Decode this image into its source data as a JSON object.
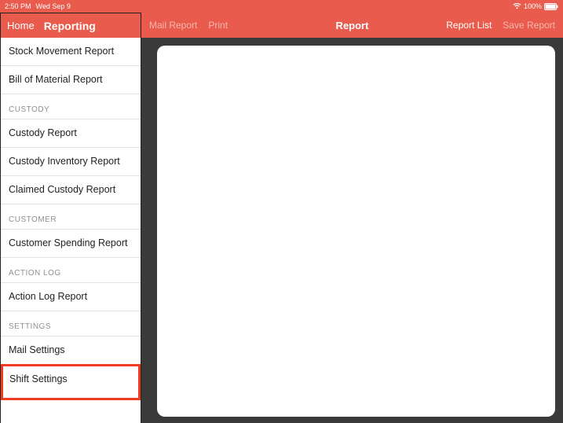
{
  "status": {
    "time": "2:50 PM",
    "date": "Wed Sep 9",
    "battery_pct": "100%"
  },
  "topnav": {
    "home": "Home",
    "reporting": "Reporting"
  },
  "toolbar": {
    "mail_report": "Mail Report",
    "print": "Print",
    "title": "Report",
    "report_list": "Report List",
    "save_report": "Save Report"
  },
  "sidebar": {
    "items": [
      {
        "label": "Stock Movement Report"
      },
      {
        "label": "Bill of Material Report"
      }
    ],
    "custody_header": "CUSTODY",
    "custody_items": [
      {
        "label": "Custody Report"
      },
      {
        "label": "Custody Inventory Report"
      },
      {
        "label": "Claimed Custody Report"
      }
    ],
    "customer_header": "CUSTOMER",
    "customer_items": [
      {
        "label": "Customer Spending Report"
      }
    ],
    "actionlog_header": "ACTION LOG",
    "actionlog_items": [
      {
        "label": "Action Log Report"
      }
    ],
    "settings_header": "SETTINGS",
    "settings_items": [
      {
        "label": "Mail Settings"
      },
      {
        "label": "Shift Settings"
      }
    ]
  }
}
